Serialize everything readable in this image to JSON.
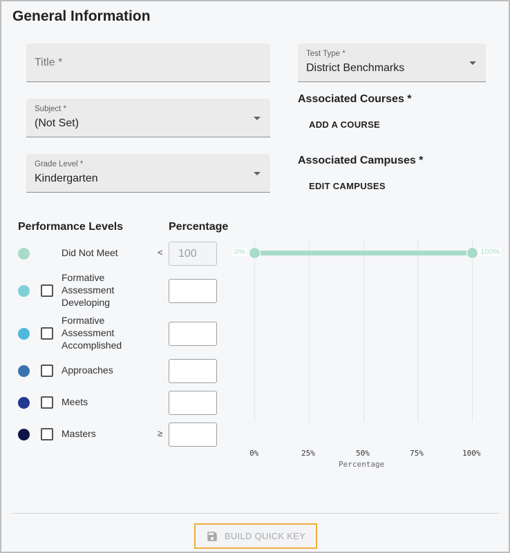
{
  "section": {
    "title": "General Information"
  },
  "form": {
    "title_field": {
      "placeholder": "Title *"
    },
    "test_type": {
      "label": "Test Type *",
      "value": "District Benchmarks"
    },
    "subject": {
      "label": "Subject *",
      "value": "(Not Set)"
    },
    "grade_level": {
      "label": "Grade Level *",
      "value": "Kindergarten"
    },
    "associated_courses": {
      "heading": "Associated Courses *",
      "button": "ADD A COURSE"
    },
    "associated_campuses": {
      "heading": "Associated Campuses *",
      "button": "EDIT CAMPUSES"
    }
  },
  "performance": {
    "col_levels": "Performance Levels",
    "col_percentage": "Percentage",
    "levels": [
      {
        "label": "Did Not Meet",
        "color": "#a8dcc8",
        "operator": "<",
        "value": "100",
        "has_checkbox": false,
        "checked": false
      },
      {
        "label": "Formative Assessment Developing",
        "color": "#7fd0d6",
        "operator": "",
        "value": "",
        "has_checkbox": true,
        "checked": false
      },
      {
        "label": "Formative Assessment Accomplished",
        "color": "#4fb8dc",
        "operator": "",
        "value": "",
        "has_checkbox": true,
        "checked": false
      },
      {
        "label": "Approaches",
        "color": "#3a72ad",
        "operator": "",
        "value": "",
        "has_checkbox": true,
        "checked": false
      },
      {
        "label": "Meets",
        "color": "#22398e",
        "operator": "",
        "value": "",
        "has_checkbox": true,
        "checked": false
      },
      {
        "label": "Masters",
        "color": "#0e1546",
        "operator": "≥",
        "value": "",
        "has_checkbox": true,
        "checked": false
      }
    ]
  },
  "chart_data": {
    "type": "range",
    "xlabel": "Percentage",
    "x_ticks": [
      "0%",
      "25%",
      "50%",
      "75%",
      "100%"
    ],
    "xlim": [
      0,
      100
    ],
    "ranges": [
      {
        "series": "Did Not Meet",
        "start": 0,
        "end": 100,
        "start_label": "0%",
        "end_label": "100%",
        "color": "#a8dcc8"
      }
    ],
    "grid": true
  },
  "footer": {
    "build_button": "BUILD QUICK KEY"
  },
  "icons": {
    "build_button_icon": "save-icon"
  }
}
